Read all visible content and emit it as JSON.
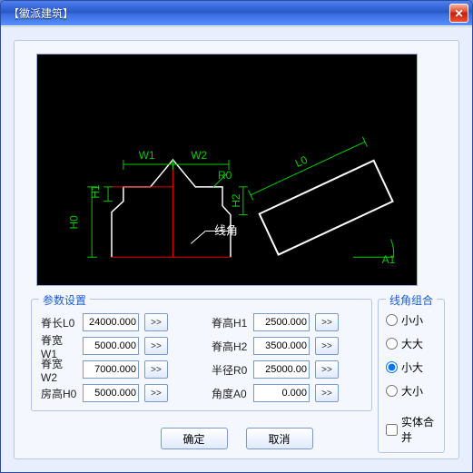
{
  "window": {
    "title": "【徽派建筑】"
  },
  "params": {
    "legend": "参数设置",
    "fields": {
      "L0": {
        "label": "脊长L0",
        "value": "24000.000",
        "spin": ">>"
      },
      "H1": {
        "label": "脊高H1",
        "value": "2500.000",
        "spin": ">>"
      },
      "W1": {
        "label": "脊宽W1",
        "value": "5000.000",
        "spin": ">>"
      },
      "H2": {
        "label": "脊高H2",
        "value": "3500.000",
        "spin": ">>"
      },
      "W2": {
        "label": "脊宽W2",
        "value": "7000.000",
        "spin": ">>"
      },
      "R0": {
        "label": "半径R0",
        "value": "25000.00",
        "spin": ">>"
      },
      "H0": {
        "label": "房高H0",
        "value": "5000.000",
        "spin": ">>"
      },
      "A0": {
        "label": "角度A0",
        "value": "0.000",
        "spin": ">>"
      }
    }
  },
  "corner": {
    "legend": "线角组合",
    "opts": {
      "ss": "小小",
      "ll": "大大",
      "sl": "小大",
      "ls": "大小"
    },
    "selected": "sl",
    "merge_label": "实体合并",
    "merge": false
  },
  "buttons": {
    "ok": "确定",
    "cancel": "取消"
  },
  "preview": {
    "W1": "W1",
    "W2": "W2",
    "H0": "H0",
    "H1": "H1",
    "H2": "H2",
    "R0": "R0",
    "L0": "L0",
    "A1": "A1",
    "ann": "线角"
  }
}
